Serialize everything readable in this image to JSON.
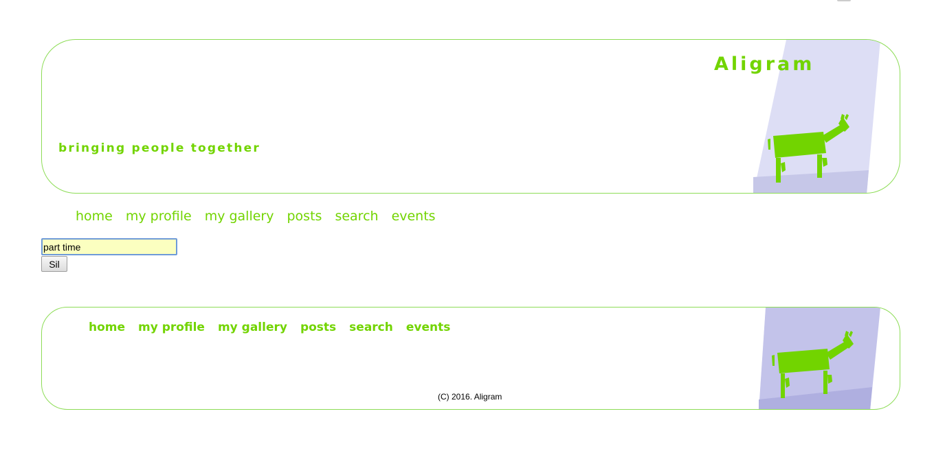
{
  "site": {
    "title": "Aligram",
    "tagline": "bringing people together"
  },
  "nav": {
    "items": [
      {
        "label": "home"
      },
      {
        "label": "my profile"
      },
      {
        "label": "my gallery"
      },
      {
        "label": "posts"
      },
      {
        "label": "search"
      },
      {
        "label": "events"
      }
    ]
  },
  "form": {
    "input_value": "part time",
    "button_label": "Sil"
  },
  "footer": {
    "copyright": "(C) 2016. Aligram"
  },
  "colors": {
    "accent": "#72d400",
    "border": "#8cdc55",
    "panel": "#dddef5",
    "panel_dark": "#c3c3ea",
    "input_bg": "#fbffc0"
  },
  "icons": {
    "logo": "green-horse-logo"
  }
}
